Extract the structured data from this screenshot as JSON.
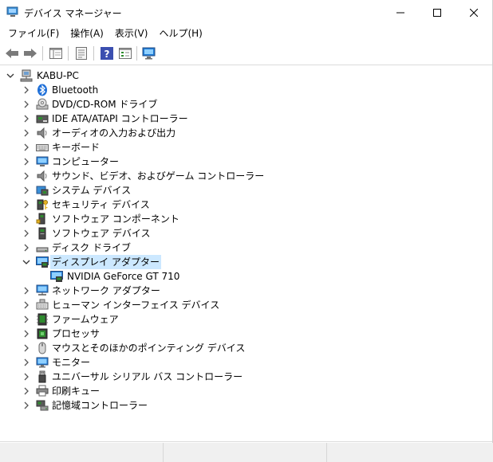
{
  "window": {
    "title": "デバイス マネージャー",
    "icon": "device-manager-icon"
  },
  "menu": [
    {
      "label": "ファイル(F)"
    },
    {
      "label": "操作(A)"
    },
    {
      "label": "表示(V)"
    },
    {
      "label": "ヘルプ(H)"
    }
  ],
  "toolbar": {
    "buttons": [
      "back-icon",
      "forward-icon",
      "properties-view-icon",
      "properties-icon",
      "help-icon",
      "view-list-icon",
      "monitor-scan-icon"
    ]
  },
  "tree": {
    "root": {
      "label": "KABU-PC",
      "icon": "computer-network-icon",
      "expanded": true
    },
    "items": [
      {
        "label": "Bluetooth",
        "icon": "bluetooth-icon",
        "expanded": false
      },
      {
        "label": "DVD/CD-ROM ドライブ",
        "icon": "dvd-drive-icon",
        "expanded": false
      },
      {
        "label": "IDE ATA/ATAPI コントローラー",
        "icon": "ide-controller-icon",
        "expanded": false
      },
      {
        "label": "オーディオの入力および出力",
        "icon": "speaker-icon",
        "expanded": false
      },
      {
        "label": "キーボード",
        "icon": "keyboard-icon",
        "expanded": false
      },
      {
        "label": "コンピューター",
        "icon": "computer-icon",
        "expanded": false
      },
      {
        "label": "サウンド、ビデオ、およびゲーム コントローラー",
        "icon": "speaker-icon",
        "expanded": false
      },
      {
        "label": "システム デバイス",
        "icon": "system-devices-icon",
        "expanded": false
      },
      {
        "label": "セキュリティ デバイス",
        "icon": "security-key-icon",
        "expanded": false
      },
      {
        "label": "ソフトウェア コンポーネント",
        "icon": "software-component-icon",
        "expanded": false
      },
      {
        "label": "ソフトウェア デバイス",
        "icon": "software-device-icon",
        "expanded": false
      },
      {
        "label": "ディスク ドライブ",
        "icon": "disk-drive-icon",
        "expanded": false
      },
      {
        "label": "ディスプレイ アダプター",
        "icon": "display-adapter-icon",
        "expanded": true,
        "selected": true,
        "children": [
          {
            "label": "NVIDIA GeForce GT 710",
            "icon": "display-adapter-icon"
          }
        ]
      },
      {
        "label": "ネットワーク アダプター",
        "icon": "network-adapter-icon",
        "expanded": false
      },
      {
        "label": "ヒューマン インターフェイス デバイス",
        "icon": "hid-icon",
        "expanded": false
      },
      {
        "label": "ファームウェア",
        "icon": "firmware-icon",
        "expanded": false
      },
      {
        "label": "プロセッサ",
        "icon": "processor-icon",
        "expanded": false
      },
      {
        "label": "マウスとそのほかのポインティング デバイス",
        "icon": "mouse-icon",
        "expanded": false
      },
      {
        "label": "モニター",
        "icon": "monitor-icon",
        "expanded": false
      },
      {
        "label": "ユニバーサル シリアル バス コントローラー",
        "icon": "usb-icon",
        "expanded": false
      },
      {
        "label": "印刷キュー",
        "icon": "printer-icon",
        "expanded": false
      },
      {
        "label": "記憶域コントローラー",
        "icon": "storage-controller-icon",
        "expanded": false
      }
    ]
  },
  "colors": {
    "selection": "#cce8ff",
    "accent_blue": "#1e7bd8",
    "green_chip": "#2e8b2e"
  }
}
